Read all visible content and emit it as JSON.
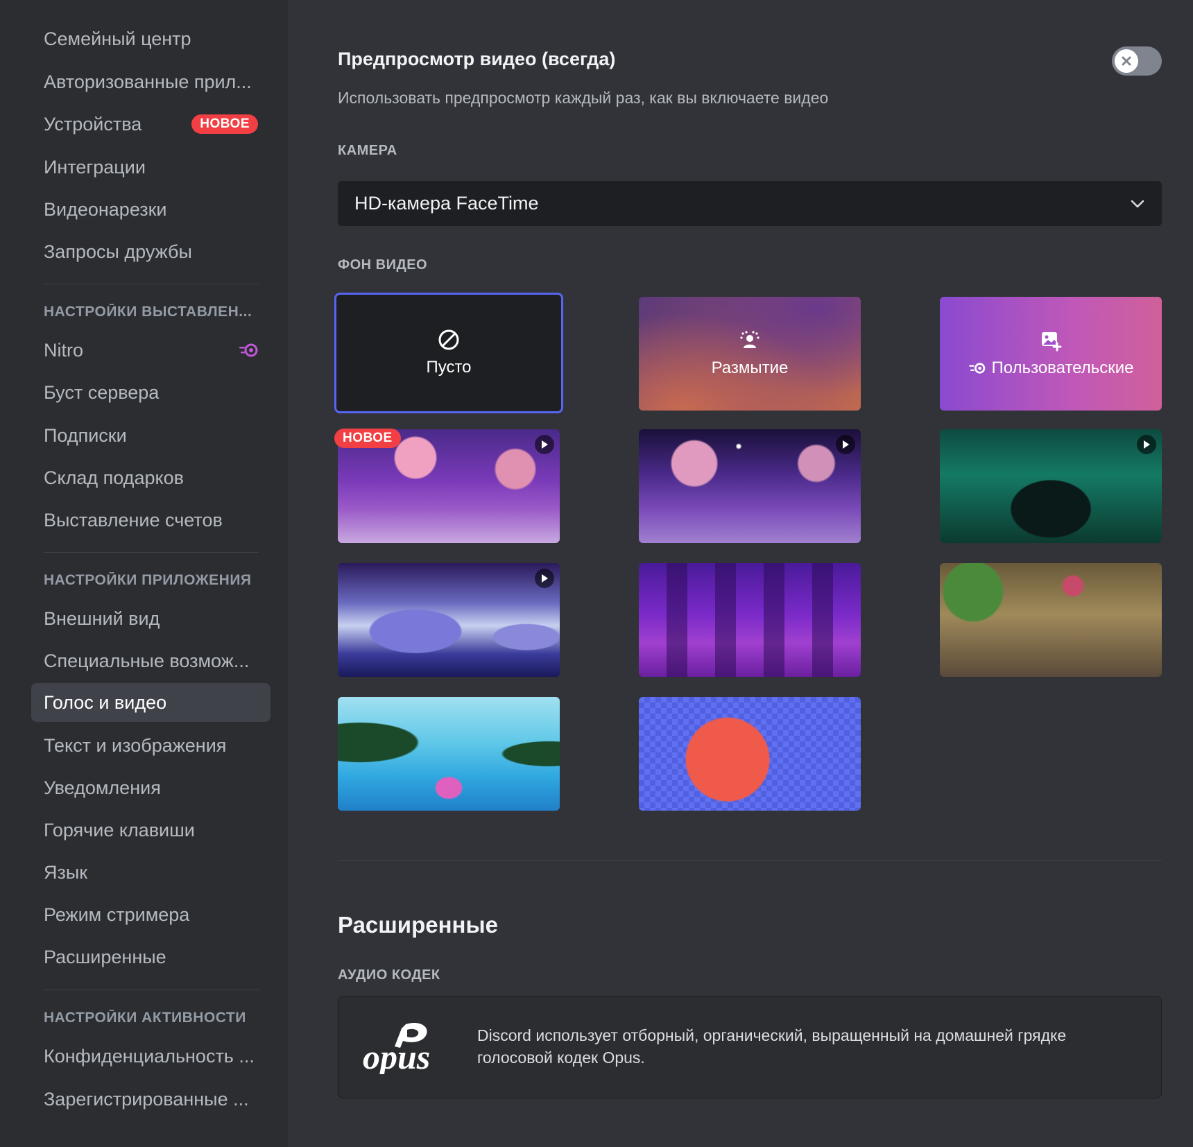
{
  "sidebar": {
    "items_top": [
      {
        "label": "Семейный центр"
      },
      {
        "label": "Авторизованные прил..."
      },
      {
        "label": "Устройства",
        "badge": "НОВОЕ"
      },
      {
        "label": "Интеграции"
      },
      {
        "label": "Видеонарезки"
      },
      {
        "label": "Запросы дружбы"
      }
    ],
    "billing_header": "НАСТРОЙКИ ВЫСТАВЛЕН...",
    "billing_items": [
      {
        "label": "Nitro",
        "icon": "nitro-icon"
      },
      {
        "label": "Буст сервера"
      },
      {
        "label": "Подписки"
      },
      {
        "label": "Склад подарков"
      },
      {
        "label": "Выставление счетов"
      }
    ],
    "app_header": "НАСТРОЙКИ ПРИЛОЖЕНИЯ",
    "app_items": [
      {
        "label": "Внешний вид"
      },
      {
        "label": "Специальные возмож..."
      },
      {
        "label": "Голос и видео",
        "active": true
      },
      {
        "label": "Текст и изображения"
      },
      {
        "label": "Уведомления"
      },
      {
        "label": "Горячие клавиши"
      },
      {
        "label": "Язык"
      },
      {
        "label": "Режим стримера"
      },
      {
        "label": "Расширенные"
      }
    ],
    "activity_header": "НАСТРОЙКИ АКТИВНОСТИ",
    "activity_items": [
      {
        "label": "Конфиденциальность ..."
      },
      {
        "label": "Зарегистрированные ..."
      }
    ]
  },
  "preview": {
    "title": "Предпросмотр видео (всегда)",
    "description": "Использовать предпросмотр каждый раз, как вы включаете видео",
    "toggle_on": false
  },
  "camera": {
    "label": "КАМЕРА",
    "value": "HD-камера FaceTime"
  },
  "background": {
    "label": "ФОН ВИДЕО",
    "options": [
      {
        "label": "Пусто",
        "icon": "none-icon",
        "selected": true
      },
      {
        "label": "Размытие",
        "icon": "blur-icon"
      },
      {
        "label": "Пользовательские",
        "icon": "add-image-icon",
        "nitro": true
      }
    ],
    "new_badge": "НОВОЕ"
  },
  "advanced": {
    "title": "Расширенные",
    "codec_label": "АУДИО КОДЕК",
    "codec_logo": "opus",
    "codec_text": "Discord использует отборный, органический, выращенный на домашней грядке голосовой кодек Opus."
  },
  "colors": {
    "accent": "#5865f2",
    "badge_red": "#f23f43",
    "nitro_pink": "#c058d8"
  }
}
